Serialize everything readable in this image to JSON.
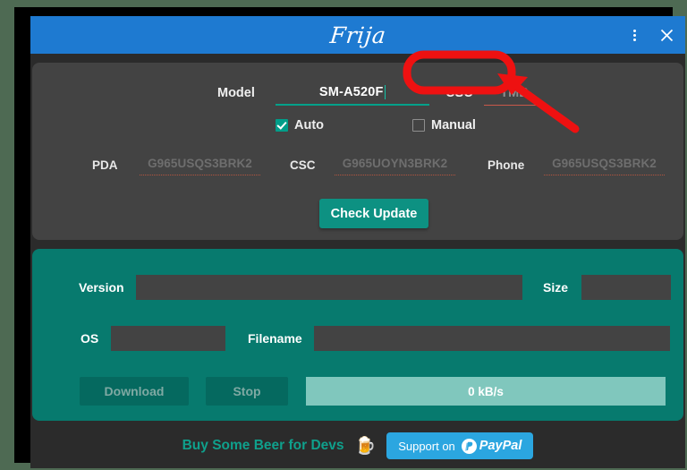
{
  "window": {
    "title": "Frija",
    "menu_icon": "three-dots-vertical-icon",
    "close_icon": "close-x-icon"
  },
  "top_panel": {
    "model_label": "Model",
    "model_value": "SM-A520F",
    "csc_label": "CSC",
    "csc_placeholder": "TMB",
    "auto_label": "Auto",
    "auto_checked": "checked",
    "manual_label": "Manual",
    "manual_checked": "unchecked",
    "firmware": [
      {
        "label": "PDA",
        "value": "G965USQS3BRK2"
      },
      {
        "label": "CSC",
        "value": "G965UOYN3BRK2"
      },
      {
        "label": "Phone",
        "value": "G965USQS3BRK2"
      }
    ],
    "check_update_label": "Check Update"
  },
  "download_panel": {
    "version_label": "Version",
    "version_value": "",
    "size_label": "Size",
    "size_value": "",
    "os_label": "OS",
    "os_value": "",
    "filename_label": "Filename",
    "filename_value": "",
    "download_label": "Download",
    "stop_label": "Stop",
    "progress_text": "0 kB/s"
  },
  "footer": {
    "beer_label": "Buy Some Beer for Devs",
    "beer_icon": "beer-mug-icon",
    "paypal_label": "Support on",
    "paypal_wordmark": "PayPal"
  },
  "annotation": {
    "shape": "red-rounded-rectangle-highlight",
    "arrow": "red-arrow-pointing-up-left",
    "color": "#ee1111"
  },
  "colors": {
    "title_bar": "#1e7ad1",
    "card": "#434343",
    "teal_panel": "#077a6e",
    "accent": "#0d9182",
    "progress": "#80c7bd",
    "paypal_blue": "#2ba6e0",
    "desktop": "#4e6a53"
  }
}
